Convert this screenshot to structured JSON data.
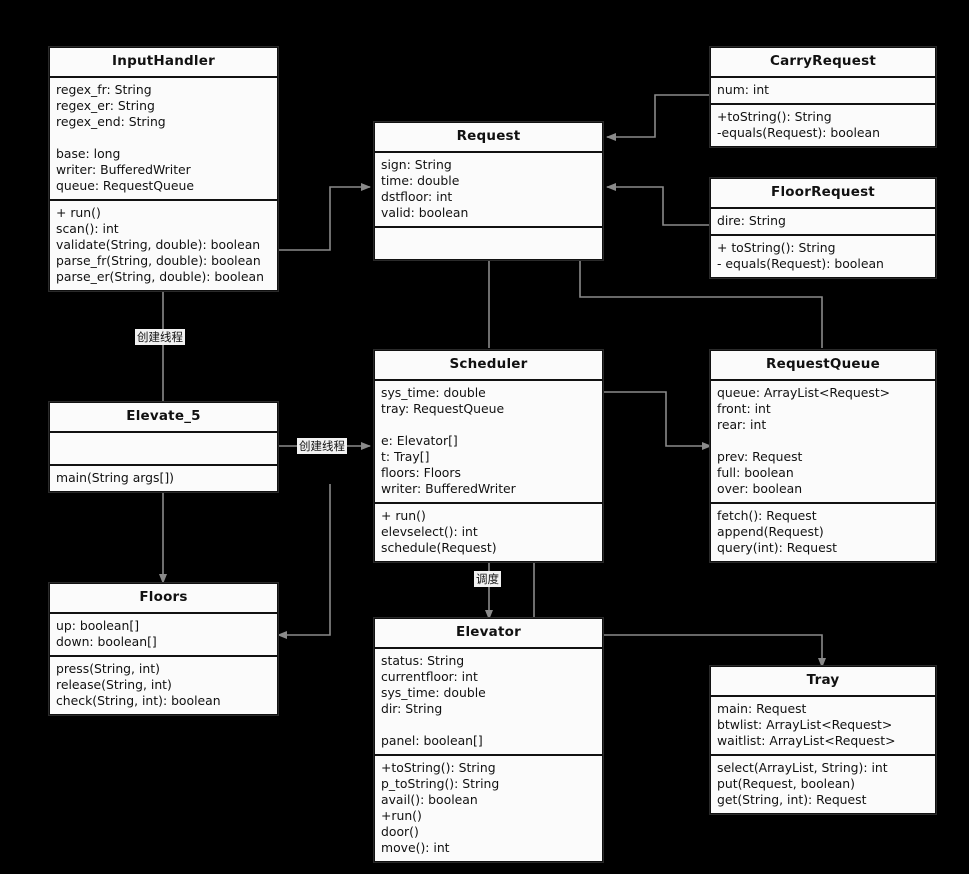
{
  "diagram": {
    "kind": "uml-class-diagram",
    "background": "#000000",
    "box_fill": "#fbfbfb",
    "line_color": "#8a8a8a"
  },
  "classes": {
    "input_handler": {
      "name": "InputHandler",
      "attributes": [
        "regex_fr: String",
        "regex_er: String",
        "regex_end: String",
        "",
        "base: long",
        "writer: BufferedWriter",
        "queue: RequestQueue"
      ],
      "methods": [
        "+ run()",
        "scan(): int",
        "validate(String, double): boolean",
        "parse_fr(String, double): boolean",
        "parse_er(String, double): boolean"
      ]
    },
    "request": {
      "name": "Request",
      "attributes": [
        "sign: String",
        "time: double",
        "dstfloor: int",
        "valid: boolean"
      ],
      "methods": []
    },
    "carry_request": {
      "name": "CarryRequest",
      "attributes": [
        "num: int"
      ],
      "methods": [
        "+toString(): String",
        "-equals(Request): boolean"
      ]
    },
    "floor_request": {
      "name": "FloorRequest",
      "attributes": [
        "dire: String"
      ],
      "methods": [
        "+ toString(): String",
        "- equals(Request): boolean"
      ]
    },
    "elevate_5": {
      "name": "Elevate_5",
      "attributes": [],
      "methods": [
        "main(String args[])"
      ]
    },
    "scheduler": {
      "name": "Scheduler",
      "attributes": [
        "sys_time: double",
        "tray: RequestQueue",
        "",
        "e: Elevator[]",
        "t: Tray[]",
        "floors: Floors",
        "writer: BufferedWriter"
      ],
      "methods": [
        "+ run()",
        "elevselect(): int",
        "schedule(Request)"
      ]
    },
    "request_queue": {
      "name": "RequestQueue",
      "attributes": [
        "queue: ArrayList<Request>",
        "front: int",
        "rear: int",
        "",
        "prev: Request",
        "full: boolean",
        "over: boolean"
      ],
      "methods": [
        "fetch(): Request",
        "append(Request)",
        "query(int): Request"
      ]
    },
    "floors": {
      "name": "Floors",
      "attributes": [
        "up: boolean[]",
        "down: boolean[]"
      ],
      "methods": [
        "press(String, int)",
        "release(String, int)",
        "check(String, int): boolean"
      ]
    },
    "elevator": {
      "name": "Elevator",
      "attributes": [
        "status: String",
        "currentfloor: int",
        "sys_time: double",
        "dir: String",
        "",
        "panel: boolean[]"
      ],
      "methods": [
        "+toString(): String",
        "p_toString(): String",
        "avail(): boolean",
        "+run()",
        "door()",
        "move(): int"
      ]
    },
    "tray": {
      "name": "Tray",
      "attributes": [
        "main: Request",
        "btwlist: ArrayList<Request>",
        "waitlist: ArrayList<Request>"
      ],
      "methods": [
        "select(ArrayList, String): int",
        "put(Request, boolean)",
        "get(String, int): Request"
      ]
    }
  },
  "edge_labels": {
    "elevate5_to_inputhandler": "创建线程",
    "elevate5_to_scheduler": "创建线程",
    "scheduler_to_elevator": "调度"
  }
}
